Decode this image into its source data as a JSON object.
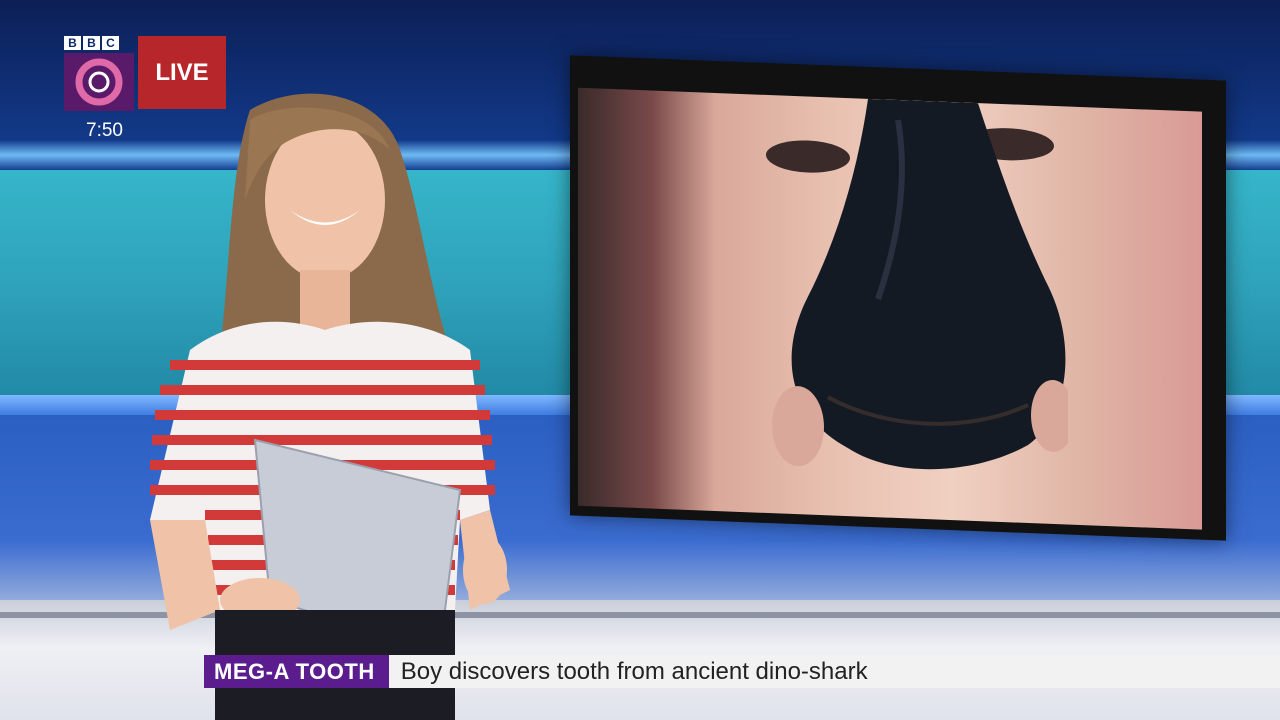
{
  "broadcast": {
    "network_letters": [
      "B",
      "B",
      "C"
    ],
    "live_label": "LIVE",
    "time": "7:50"
  },
  "monitor": {
    "content": "photo-of-boy-holding-tooth"
  },
  "lower_third": {
    "tag": "MEG-A TOOTH",
    "headline": "Boy discovers tooth from ancient dino-shark"
  },
  "colors": {
    "live_red": "#b7262b",
    "tag_purple": "#5b1d8e",
    "logo_purple": "#5a1a6a",
    "studio_blue": "#1c4fb0",
    "studio_teal": "#2fa3bb"
  }
}
